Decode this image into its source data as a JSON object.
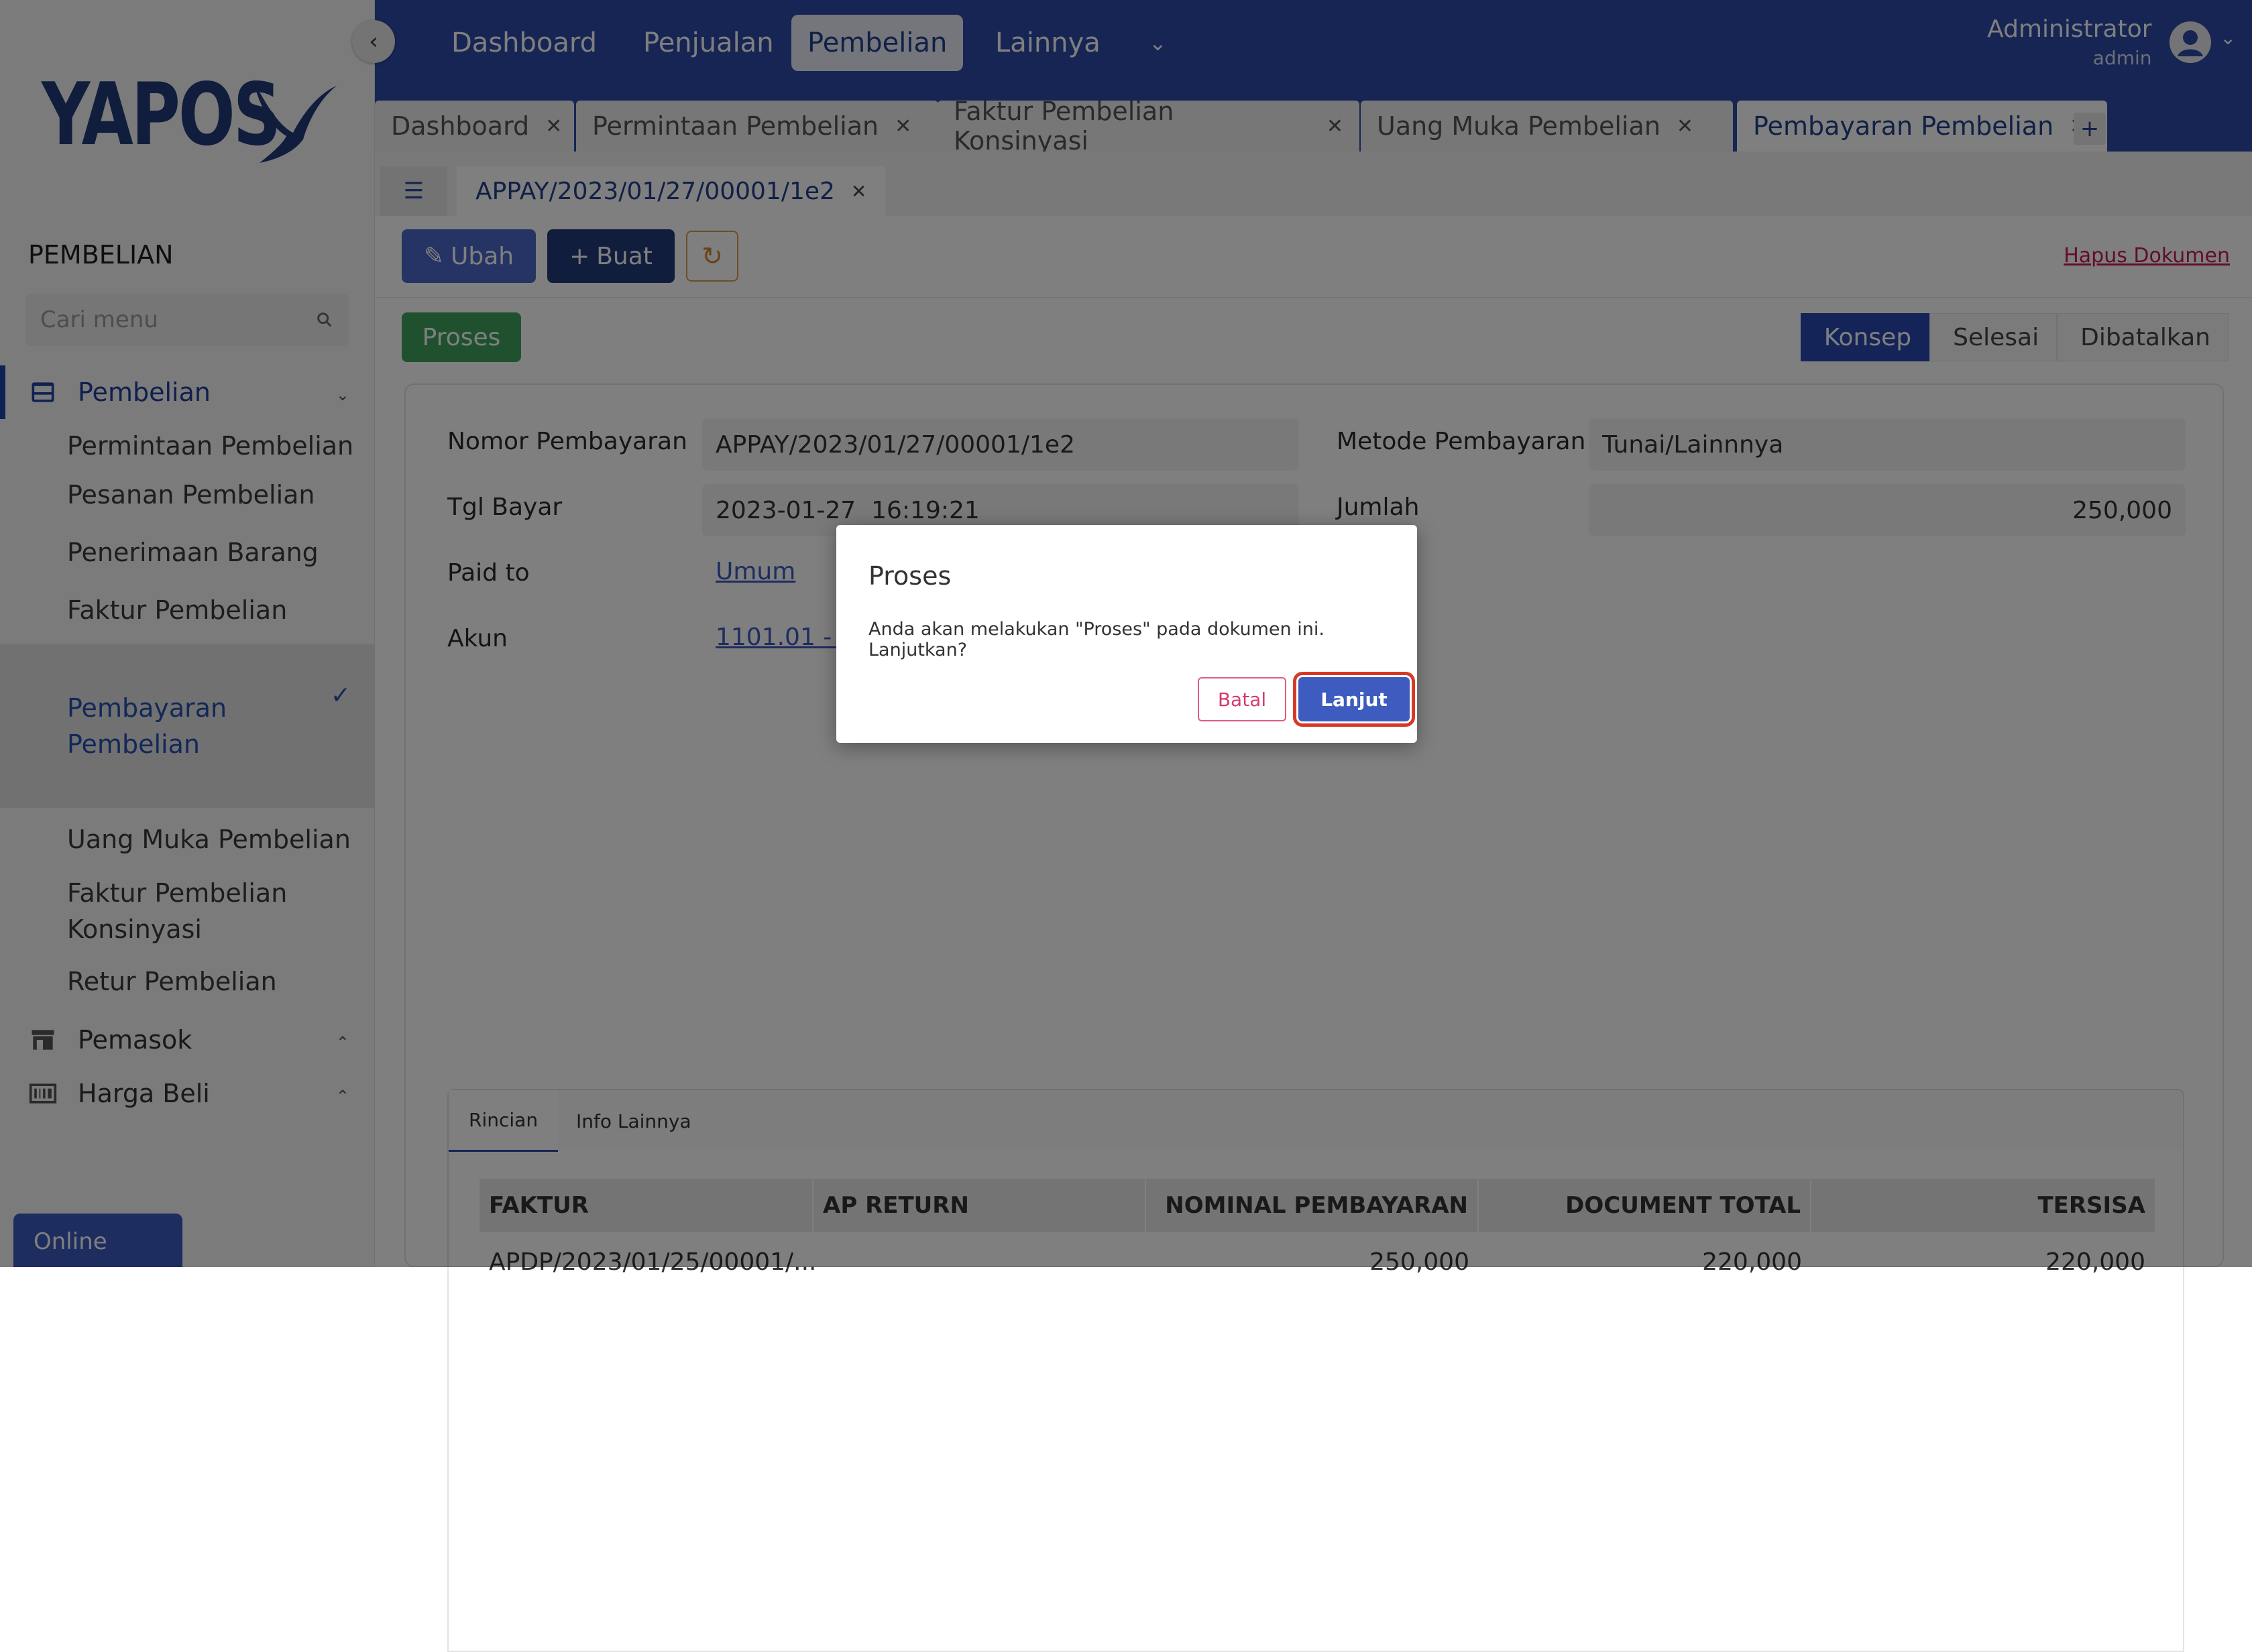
{
  "app": {
    "logo": "YAPOS"
  },
  "sidebar": {
    "section_title": "PEMBELIAN",
    "search_placeholder": "Cari menu",
    "parent_pembelian": "Pembelian",
    "items": [
      {
        "label": "Permintaan Pembelian"
      },
      {
        "label": "Pesanan Pembelian"
      },
      {
        "label": "Penerimaan Barang"
      },
      {
        "label": "Faktur Pembelian"
      },
      {
        "label": "Pembayaran\nPembelian",
        "active": true
      },
      {
        "label": "Uang Muka Pembelian"
      },
      {
        "label": "Faktur Pembelian\nKonsinyasi"
      },
      {
        "label": "Retur Pembelian"
      }
    ],
    "parent_pemasok": "Pemasok",
    "parent_harga_beli": "Harga Beli",
    "online": "Online"
  },
  "topnav": {
    "items": [
      "Dashboard",
      "Penjualan",
      "Pembelian",
      "Lainnya"
    ],
    "active": "Pembelian",
    "user_name": "Administrator",
    "user_role": "admin"
  },
  "tabs": [
    {
      "label": "Dashboard"
    },
    {
      "label": "Permintaan Pembelian"
    },
    {
      "label": "Faktur Pembelian Konsinyasi"
    },
    {
      "label": "Uang Muka Pembelian"
    },
    {
      "label": "Pembayaran Pembelian",
      "active": true
    }
  ],
  "record_tab": "APPAY/2023/01/27/00001/1e2",
  "toolbar": {
    "ubah": "Ubah",
    "buat": "Buat",
    "hapus": "Hapus Dokumen",
    "proses": "Proses"
  },
  "status_steps": [
    "Konsep",
    "Selesai",
    "Dibatalkan"
  ],
  "form": {
    "nomor_label": "Nomor Pembayaran",
    "nomor_value": "APPAY/2023/01/27/00001/1e2",
    "tgl_label": "Tgl Bayar",
    "tgl_value": "2023-01-27  16:19:21",
    "paid_to_label": "Paid to",
    "paid_to_value": "Umum",
    "akun_label": "Akun",
    "akun_value": "1101.01 - K",
    "metode_label": "Metode Pembayaran",
    "metode_value": "Tunai/Lainnnya",
    "jumlah_label": "Jumlah",
    "jumlah_value": "250,000"
  },
  "inner_tabs": [
    "Rincian",
    "Info Lainnya"
  ],
  "table": {
    "columns": [
      "FAKTUR",
      "AP RETURN",
      "NOMINAL PEMBAYARAN",
      "DOCUMENT TOTAL",
      "TERSISA"
    ],
    "rows": [
      [
        "APDP/2023/01/25/00001/...",
        "",
        "250,000",
        "220,000",
        "220,000"
      ]
    ]
  },
  "modal": {
    "title": "Proses",
    "message": "Anda akan melakukan \"Proses\" pada dokumen ini. Lanjutkan?",
    "cancel": "Batal",
    "confirm": "Lanjut"
  }
}
